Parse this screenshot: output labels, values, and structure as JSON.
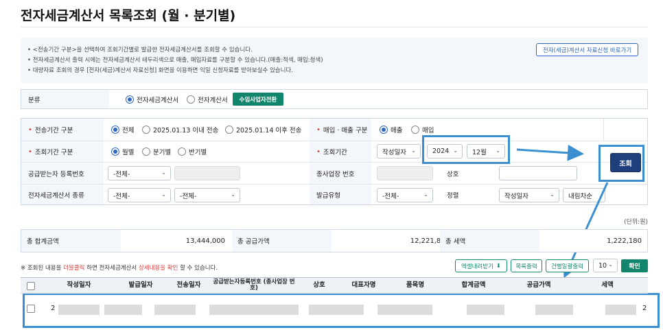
{
  "page": {
    "title": "전자세금계산서 목록조회 (월 · 분기별)"
  },
  "notice": {
    "lines": [
      "• <전송기간 구분>을 선택하여 조회기간별로 발급한 전자세금계산서를 조회할 수 있습니다.",
      "• 전자세금계산서 출력 시에는 전자세금계산서 테두리색으로 매출, 매입자료를 구분할 수 있습니다.(매출:적색, 매입:청색)",
      "• 대량자료 조회의 경우 [전자(세금)계산서 자료신청] 화면을 이용하면 익일 신청자료를 받아보실수 있습니다."
    ],
    "link_button": "전자(세금)계산서 자료신청 바로가기"
  },
  "category": {
    "label": "분류",
    "options": [
      "전자세금계산서",
      "전자계산서"
    ],
    "selected": "전자세금계산서",
    "switch_button": "수임사업자전환"
  },
  "filters": {
    "transmission_period": {
      "label": "전송기간 구분",
      "options": [
        "전체",
        "2025.01.13 이내 전송",
        "2025.01.14 이후 전송"
      ],
      "selected": "전체"
    },
    "purchase_sales": {
      "label": "매입 · 매출 구분",
      "options": [
        "매출",
        "매입"
      ],
      "selected": "매출"
    },
    "query_period_type": {
      "label": "조회기간 구분",
      "options": [
        "월별",
        "분기별",
        "반기별"
      ],
      "selected": "월별"
    },
    "query_period": {
      "label": "조회기간",
      "date_type": "작성일자",
      "year": "2024",
      "month": "12월"
    },
    "search_button": "조회",
    "recipient_reg_no": {
      "label": "공급받는자 등록번호",
      "value": "-전체-"
    },
    "sub_business_no": {
      "label": "종사업장 번호"
    },
    "company_name": {
      "label": "상호"
    },
    "invoice_type": {
      "label": "전자세금계산서 종류",
      "value1": "-전체-",
      "value2": "-전체-"
    },
    "issue_type": {
      "label": "발급유형",
      "value": "-전체-"
    },
    "sort": {
      "label": "정렬",
      "field": "작성일자",
      "order": "내림차순"
    }
  },
  "totals": {
    "unit": "(단위:원)",
    "total_label": "총 합계금액",
    "total_value": "13,444,000",
    "supply_label": "총 공급가액",
    "supply_value": "12,221,820",
    "tax_label": "총 세액",
    "tax_value": "1,222,180"
  },
  "results_bar": {
    "hint_prefix": "※ 조회된 내용을 ",
    "hint_red1": "더블클릭",
    "hint_mid": " 하면 전자세금계산서 ",
    "hint_red2": "상세내용을 확인",
    "hint_suffix": " 할 수 있습니다.",
    "excel_button": "엑셀내려받기",
    "print_list_button": "목록출력",
    "print_each_button": "건별일괄출력",
    "page_size": "10",
    "confirm_button": "확인"
  },
  "table": {
    "columns": [
      "작성일자",
      "발급일자",
      "전송일자",
      "공급받는자등록번호 (종사업장 번호)",
      "상호",
      "대표자명",
      "품목명",
      "합계금액",
      "공급가액",
      "세액"
    ],
    "row_visible_first": "2",
    "row_visible_last": "2"
  },
  "colors": {
    "accent_blue": "#2f66c2",
    "navy": "#1e3f7c",
    "green": "#12866c",
    "required_red": "#e23c3c",
    "annotation_blue": "#3b8fd0"
  }
}
